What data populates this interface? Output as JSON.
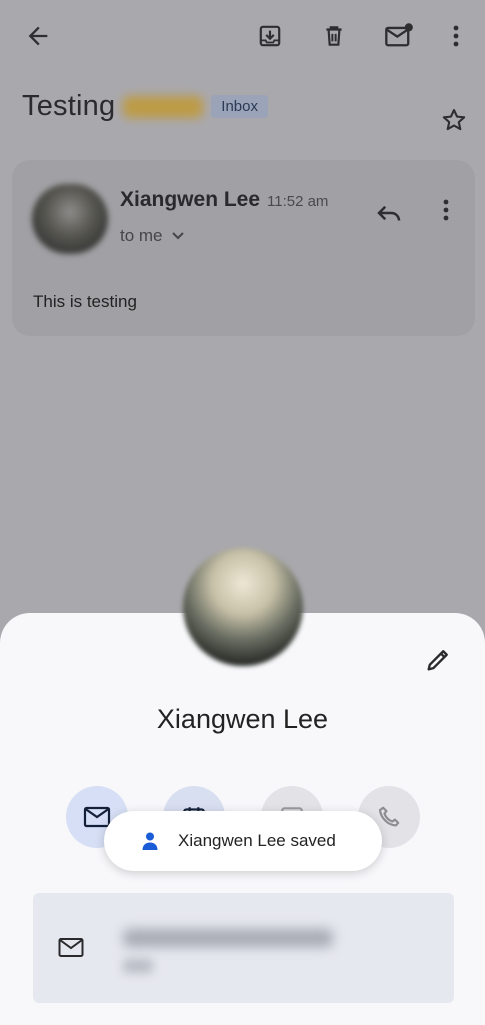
{
  "email": {
    "subject": "Testing",
    "label": "Inbox",
    "sender_name": "Xiangwen Lee",
    "time": "11:52 am",
    "recipient": "to me",
    "body": "This is testing"
  },
  "contact": {
    "name": "Xiangwen Lee"
  },
  "snackbar": {
    "message": "Xiangwen Lee saved"
  },
  "icons": {
    "back": "arrow-left-icon",
    "archive": "archive-icon",
    "delete": "trash-icon",
    "mark_unread": "mail-unread-icon",
    "more": "more-vert-icon",
    "star": "star-outline-icon",
    "reply": "reply-icon",
    "edit": "pencil-icon",
    "email": "mail-icon",
    "calendar": "calendar-icon",
    "chat": "chat-icon",
    "call": "phone-icon",
    "person": "person-icon"
  },
  "colors": {
    "scrim": "#a9a8ad",
    "sheet": "#f8f8fb",
    "accent": "#1a5bd6"
  }
}
